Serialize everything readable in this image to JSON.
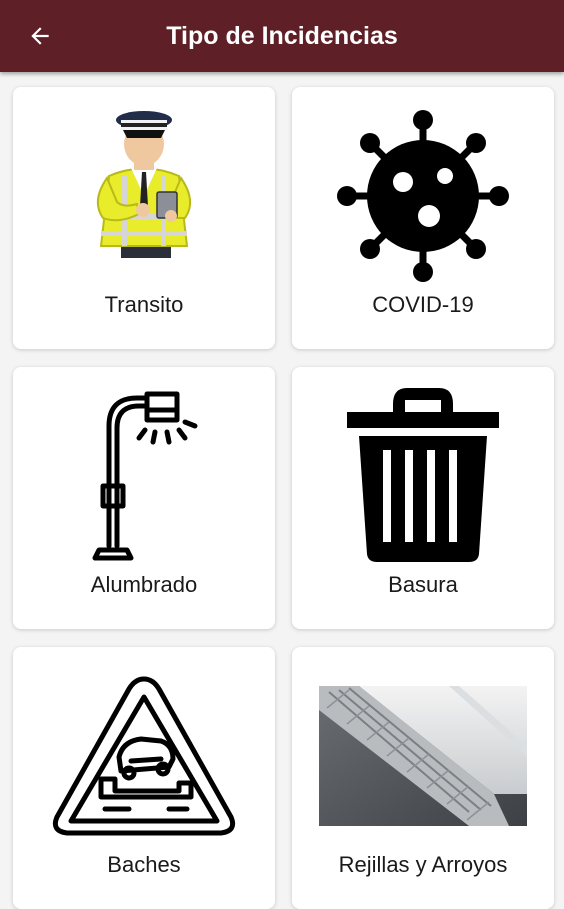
{
  "header": {
    "title": "Tipo de Incidencias",
    "back_icon": "arrow-left-icon",
    "background": "#5e1f27"
  },
  "categories": [
    {
      "label": "Transito",
      "icon": "traffic-officer-icon"
    },
    {
      "label": "COVID-19",
      "icon": "virus-icon"
    },
    {
      "label": "Alumbrado",
      "icon": "street-lamp-icon"
    },
    {
      "label": "Basura",
      "icon": "trash-can-icon"
    },
    {
      "label": "Baches",
      "icon": "pothole-warning-icon"
    },
    {
      "label": "Rejillas y Arroyos",
      "icon": "drain-grate-photo"
    }
  ]
}
